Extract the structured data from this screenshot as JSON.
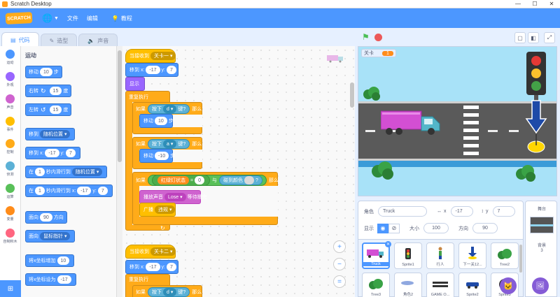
{
  "window": {
    "title": "Scratch Desktop",
    "controls": [
      "—",
      "☐",
      "✕"
    ]
  },
  "menubar": {
    "logo": "SCRATCH",
    "menu_file": "文件",
    "menu_edit": "编辑",
    "tutorials": "教程"
  },
  "tabs": [
    {
      "label": "代码",
      "icon": "code-icon"
    },
    {
      "label": "造型",
      "icon": "brush-icon"
    },
    {
      "label": "声音",
      "icon": "speaker-icon"
    }
  ],
  "categories": [
    {
      "label": "运动",
      "color": "#4c97ff"
    },
    {
      "label": "外观",
      "color": "#9966ff"
    },
    {
      "label": "声音",
      "color": "#cf63cf"
    },
    {
      "label": "事件",
      "color": "#ffbf00"
    },
    {
      "label": "控制",
      "color": "#ffab19"
    },
    {
      "label": "侦测",
      "color": "#5cb1d6"
    },
    {
      "label": "运算",
      "color": "#59c059"
    },
    {
      "label": "变量",
      "color": "#ff8c1a"
    },
    {
      "label": "自制积木",
      "color": "#ff6680"
    }
  ],
  "palette": {
    "heading": "运动",
    "move": "移动",
    "move_steps": "10",
    "steps": "步",
    "turn_right": "右转",
    "turn_right_deg": "15",
    "deg": "度",
    "turn_left": "左转",
    "turn_left_deg": "15",
    "goto": "移到",
    "goto_target": "随机位置",
    "goto_xy": "移到 x:",
    "goto_x": "-17",
    "y_label": "y:",
    "goto_y": "7",
    "glide_in": "在",
    "glide_secs": "1",
    "glide_to": "秒内滑行到",
    "glide_target": "随机位置",
    "glide_xy_to": "秒内滑行到 x:",
    "glide_x": "-17",
    "glide_y": "7",
    "point": "面向",
    "point_dir": "90",
    "direction": "方向",
    "point_towards": "面向",
    "point_target": "鼠标指针",
    "change_x": "将x坐标增加",
    "change_x_val": "10",
    "set_x": "将x坐标设为",
    "set_x_val": "-17"
  },
  "code": {
    "s1_when": "当接收到",
    "s1_msg": "关卡一",
    "s1_goto": "移到 x:",
    "s1_x": "-17",
    "s1_y_label": "y:",
    "s1_y": "7",
    "s1_show": "显示",
    "s1_forever": "重复执行",
    "s1_if1": "如果",
    "s1_key1_pre": "按下",
    "s1_key1": "d",
    "s1_key1_post": "键?",
    "s1_then1": "那么",
    "s1_move1": "移动",
    "s1_move1_val": "10",
    "s1_steps": "步",
    "s1_if2": "如果",
    "s1_key2_pre": "按下",
    "s1_key2": "a",
    "s1_key2_post": "键?",
    "s1_then2": "那么",
    "s1_move2": "移动",
    "s1_move2_val": "-10",
    "s1_if3": "如果",
    "s1_var": "红绿灯状态",
    "s1_eq": "=",
    "s1_eq_val": "0",
    "s1_and": "与",
    "s1_touch": "碰到颜色",
    "s1_touch_q": "?",
    "s1_then3": "那么",
    "s1_sound": "播放声音",
    "s1_sound_name": "Lose",
    "s1_sound_post": "等待播完",
    "s1_broadcast": "广播",
    "s1_broadcast_msg": "违规",
    "s2_when": "当接收到",
    "s2_msg": "关卡二",
    "s2_goto": "移到 x:",
    "s2_x": "-17",
    "s2_y_label": "y:",
    "s2_y": "7",
    "s2_forever": "重复执行",
    "s2_if1": "如果",
    "s2_key1_pre": "按下",
    "s2_key1": "d",
    "s2_key1_post": "键?",
    "s2_then1": "那么",
    "zoom_in": "+",
    "zoom_out": "−",
    "zoom_reset": "="
  },
  "stage": {
    "monitor_label": "关卡",
    "monitor_value": "1"
  },
  "sprite_info": {
    "sprite_label": "角色",
    "sprite_name": "Truck",
    "x_label": "x",
    "x_val": "-17",
    "y_label": "y",
    "y_val": "7",
    "show_label": "显示",
    "size_label": "大小",
    "size_val": "100",
    "direction_label": "方向",
    "direction_val": "90"
  },
  "sprites": [
    {
      "name": "Truck",
      "icon": "truck-icon",
      "selected": true
    },
    {
      "name": "Sprite1",
      "icon": "traffic-light-icon"
    },
    {
      "name": "行人",
      "icon": "person-icon"
    },
    {
      "name": "下一关12...",
      "icon": "arrow-down-icon"
    },
    {
      "name": "Tree2",
      "icon": "tree-icon"
    },
    {
      "name": "Tree3",
      "icon": "tree-icon"
    },
    {
      "name": "角色2",
      "icon": "fish-icon"
    },
    {
      "name": "GAME O...",
      "icon": "game-over-icon"
    },
    {
      "name": "Sprite2",
      "icon": "car-icon"
    },
    {
      "name": "Sprite3",
      "icon": "no-sign-icon"
    }
  ],
  "stage_panel": {
    "label": "舞台",
    "backdrop_label": "背景",
    "backdrop_count": "3"
  }
}
